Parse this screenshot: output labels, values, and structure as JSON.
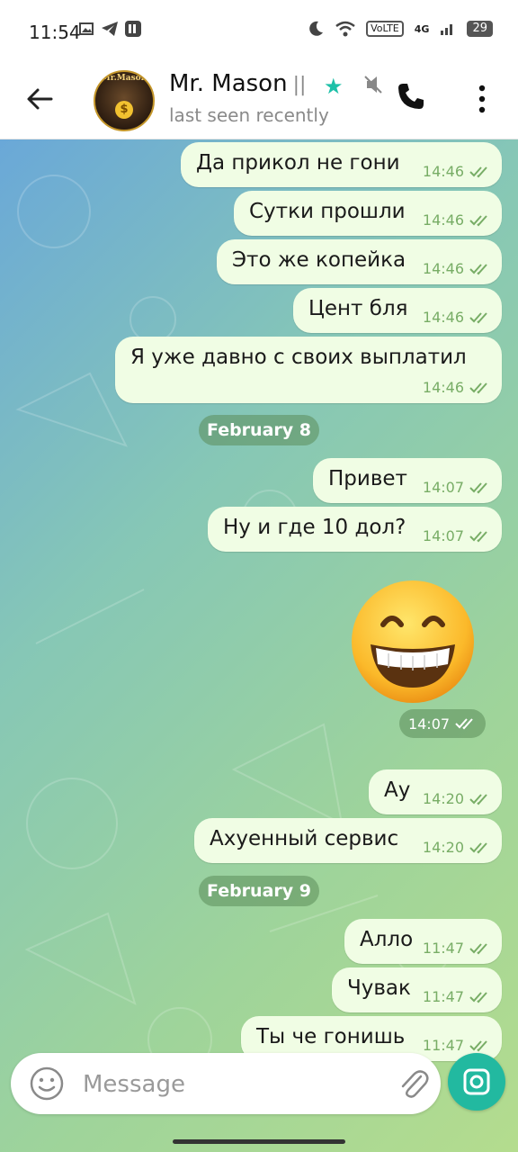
{
  "status_bar": {
    "time": "11:54",
    "network": "4G",
    "volte": "VoLTE",
    "battery": "29"
  },
  "header": {
    "title": "Mr. Mason",
    "title_suffix": "||",
    "subtitle": "last seen recently",
    "avatar_text": "Mr.Mason"
  },
  "messages": [
    {
      "text": "Да прикол не гони",
      "time": "14:46"
    },
    {
      "text": "Сутки прошли",
      "time": "14:46"
    },
    {
      "text": "Это же копейка",
      "time": "14:46"
    },
    {
      "text": "Цент бля",
      "time": "14:46"
    },
    {
      "text": "Я уже давно с своих выплатил",
      "time": "14:46"
    },
    {
      "text": "Привет",
      "time": "14:07"
    },
    {
      "text": "Ну и где 10 дол?",
      "time": "14:07"
    },
    {
      "text": "Ау",
      "time": "14:20"
    },
    {
      "text": "Ахуенный сервис",
      "time": "14:20"
    },
    {
      "text": "Алло",
      "time": "11:47"
    },
    {
      "text": "Чувак",
      "time": "11:47"
    },
    {
      "text": "Ты че гонишь",
      "time": "11:47"
    }
  ],
  "dates": [
    "February 8",
    "February 9"
  ],
  "sticker": {
    "time": "14:07"
  },
  "composer": {
    "placeholder": "Message"
  },
  "colors": {
    "accent": "#22b9a0",
    "bubble": "#f0fde4",
    "ticks": "#78ad66"
  }
}
